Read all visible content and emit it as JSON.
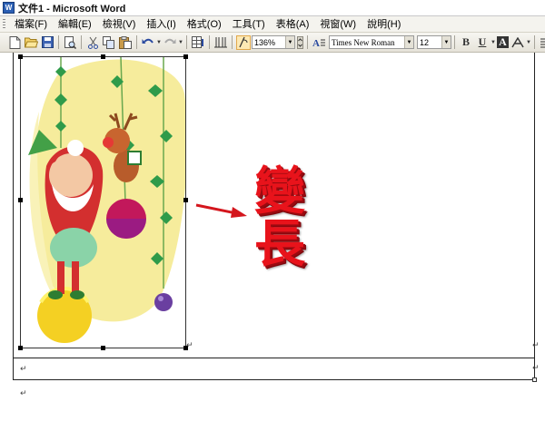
{
  "window": {
    "title": "文件1 - Microsoft Word",
    "app_icon": "word-icon"
  },
  "menu": {
    "items": [
      {
        "label": "檔案(F)"
      },
      {
        "label": "編輯(E)"
      },
      {
        "label": "檢視(V)"
      },
      {
        "label": "插入(I)"
      },
      {
        "label": "格式(O)"
      },
      {
        "label": "工具(T)"
      },
      {
        "label": "表格(A)"
      },
      {
        "label": "視窗(W)"
      },
      {
        "label": "說明(H)"
      }
    ]
  },
  "toolbar": {
    "zoom": "136%",
    "font_name": "Times New Roman",
    "font_size": "12",
    "bold": "B",
    "underline": "U",
    "text_effect": "A"
  },
  "document": {
    "annotation_chars": [
      "變",
      "長"
    ],
    "paragraph_mark": "↵",
    "colors": {
      "annotation": "#e8131b",
      "arrow": "#d4161d"
    }
  }
}
